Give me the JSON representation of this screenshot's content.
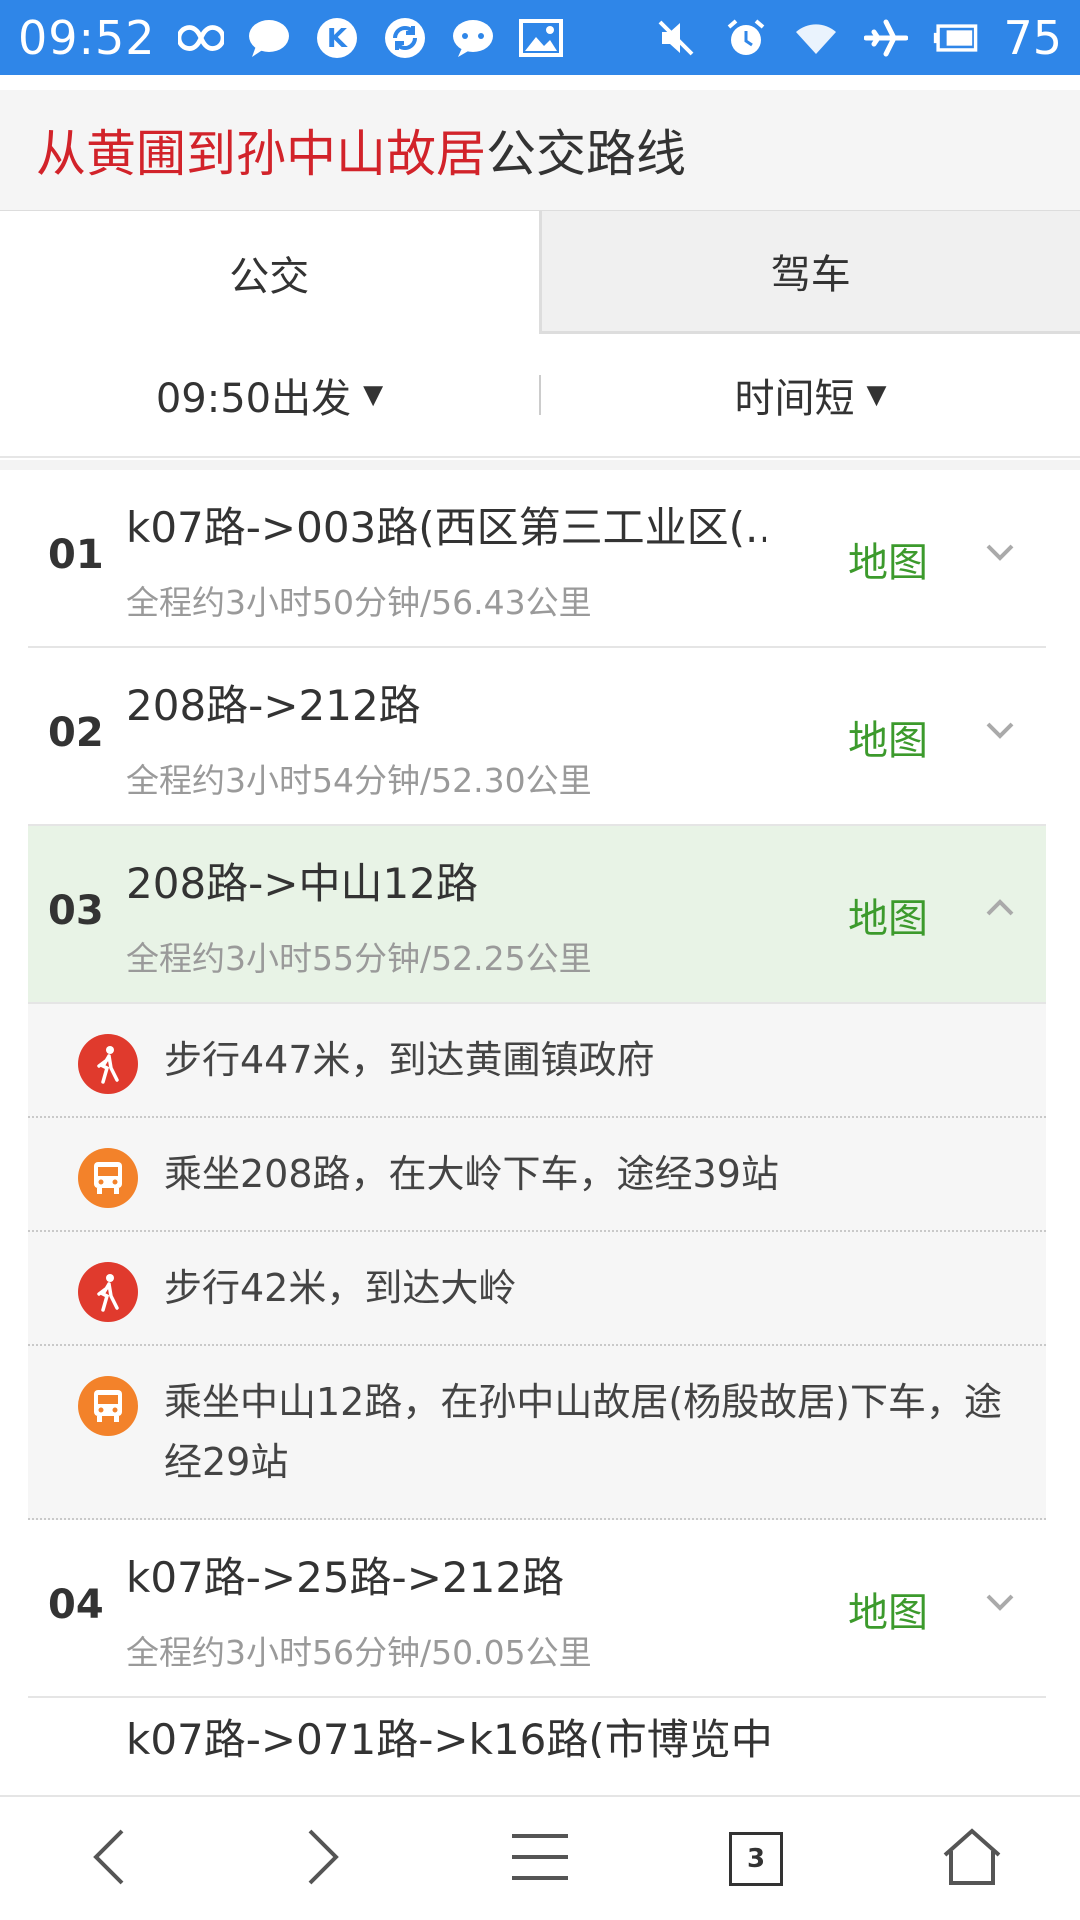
{
  "statusbar": {
    "time": "09:52",
    "battery": "75",
    "left_icons": [
      "infinity-icon",
      "chat-bubble-icon",
      "k-app-icon",
      "sync-icon",
      "message-icon",
      "image-icon"
    ],
    "right_icons": [
      "mute-icon",
      "alarm-icon",
      "wifi-icon",
      "airplane-icon",
      "battery-icon"
    ]
  },
  "header": {
    "title_highlight": "从黄圃到孙中山故居",
    "title_rest": "公交路线"
  },
  "tabs": [
    {
      "label": "公交",
      "active": true
    },
    {
      "label": "驾车",
      "active": false
    }
  ],
  "filters": {
    "depart": "09:50出发",
    "sort": "时间短"
  },
  "routes": [
    {
      "num": "01",
      "title": "k07路->003路(西区第三工业区(...",
      "sub": "全程约3小时50分钟/56.43公里",
      "map": "地图"
    },
    {
      "num": "02",
      "title": "208路->212路",
      "sub": "全程约3小时54分钟/52.30公里",
      "map": "地图"
    },
    {
      "num": "03",
      "title": "208路->中山12路",
      "sub": "全程约3小时55分钟/52.25公里",
      "map": "地图"
    },
    {
      "num": "04",
      "title": "k07路->25路->212路",
      "sub": "全程约3小时56分钟/50.05公里",
      "map": "地图"
    }
  ],
  "steps": [
    {
      "type": "walk",
      "text": "步行447米，到达黄圃镇政府"
    },
    {
      "type": "bus",
      "text": "乘坐208路，在大岭下车，途经39站"
    },
    {
      "type": "walk",
      "text": "步行42米，到达大岭"
    },
    {
      "type": "bus",
      "text": "乘坐中山12路，在孙中山故居(杨殷故居)下车，途经29站"
    }
  ],
  "partial_route": {
    "title": "k07路->071路->k16路(市博览中"
  },
  "bottomnav": {
    "tab_count": "3"
  },
  "colors": {
    "statusbar": "#2f86e8",
    "highlight_red": "#d2232a",
    "map_green": "#3c9a2c",
    "expanded_bg": "#e8f3e6",
    "walk_icon": "#e03a2d",
    "bus_icon": "#f3822a"
  }
}
